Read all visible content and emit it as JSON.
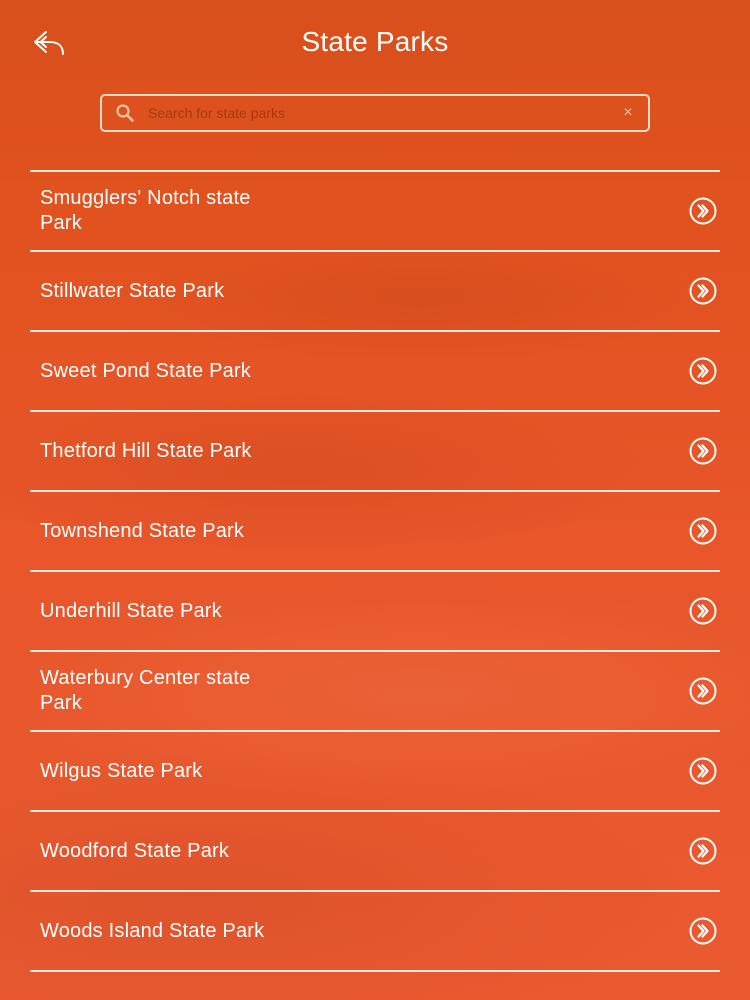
{
  "header": {
    "title": "State Parks",
    "back_icon": "back-arrow-icon"
  },
  "search": {
    "placeholder": "Search for state parks",
    "value": "",
    "icon": "search-icon",
    "clear_icon": "close-icon",
    "clear_glyph": "×"
  },
  "colors": {
    "background": "#e8562a",
    "text": "#ffffff",
    "divider": "#fff0e6"
  },
  "parks": [
    {
      "label": "Smugglers' Notch state Park",
      "icon": "chevron-double-right-icon"
    },
    {
      "label": "Stillwater State Park",
      "icon": "chevron-double-right-icon"
    },
    {
      "label": "Sweet Pond State Park",
      "icon": "chevron-double-right-icon"
    },
    {
      "label": "Thetford Hill State Park",
      "icon": "chevron-double-right-icon"
    },
    {
      "label": "Townshend State Park",
      "icon": "chevron-double-right-icon"
    },
    {
      "label": "Underhill State Park",
      "icon": "chevron-double-right-icon"
    },
    {
      "label": "Waterbury Center state Park",
      "icon": "chevron-double-right-icon"
    },
    {
      "label": "Wilgus State Park",
      "icon": "chevron-double-right-icon"
    },
    {
      "label": "Woodford State Park",
      "icon": "chevron-double-right-icon"
    },
    {
      "label": "Woods Island State Park",
      "icon": "chevron-double-right-icon"
    }
  ]
}
